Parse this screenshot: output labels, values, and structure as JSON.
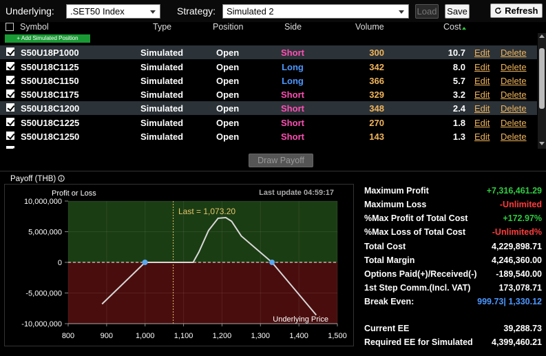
{
  "toolbar": {
    "underlying_label": "Underlying:",
    "underlying_value": ".SET50 Index",
    "strategy_label": "Strategy:",
    "strategy_value": "Simulated 2",
    "load_label": "Load",
    "save_label": "Save",
    "refresh_label": "Refresh"
  },
  "table": {
    "headers": {
      "symbol": "Symbol",
      "type": "Type",
      "position": "Position",
      "side": "Side",
      "volume": "Volume",
      "cost": "Cost"
    },
    "add_label": "+ Add Simulated Position",
    "edit_label": "Edit",
    "delete_label": "Delete",
    "rows": [
      {
        "symbol": "S50U18P1000",
        "type": "Simulated",
        "position": "Open",
        "side": "Short",
        "volume": "300",
        "cost": "10.7"
      },
      {
        "symbol": "S50U18C1125",
        "type": "Simulated",
        "position": "Open",
        "side": "Long",
        "volume": "342",
        "cost": "8.0"
      },
      {
        "symbol": "S50U18C1150",
        "type": "Simulated",
        "position": "Open",
        "side": "Long",
        "volume": "366",
        "cost": "5.7"
      },
      {
        "symbol": "S50U18C1175",
        "type": "Simulated",
        "position": "Open",
        "side": "Short",
        "volume": "329",
        "cost": "3.2"
      },
      {
        "symbol": "S50U18C1200",
        "type": "Simulated",
        "position": "Open",
        "side": "Short",
        "volume": "348",
        "cost": "2.4"
      },
      {
        "symbol": "S50U18C1225",
        "type": "Simulated",
        "position": "Open",
        "side": "Short",
        "volume": "270",
        "cost": "1.8"
      },
      {
        "symbol": "S50U18C1250",
        "type": "Simulated",
        "position": "Open",
        "side": "Short",
        "volume": "143",
        "cost": "1.3"
      }
    ],
    "colors": {
      "short": "#ff4fb5",
      "long": "#4b97ff",
      "volume": "#f0b45a",
      "highlight": "#2b3238"
    }
  },
  "draw_payoff_label": "Draw Payoff",
  "payoff_title": "Payoff (THB)",
  "chart_data": {
    "type": "line",
    "ylabel": "Profit or Loss",
    "xlabel": "Underlying Price",
    "last_update": "Last update 04:59:17",
    "last_label": "Last = 1,073.20",
    "last_value": 1073.2,
    "xlim": [
      800,
      1500
    ],
    "ylim": [
      -10000000,
      10000000
    ],
    "x_ticks": [
      "800",
      "900",
      "1,000",
      "1,100",
      "1,200",
      "1,300",
      "1,400",
      "1,500"
    ],
    "y_ticks": [
      "10,000,000",
      "5,000,000",
      "0",
      "-5,000,000",
      "-10,000,000"
    ],
    "series": [
      {
        "x": [
          888,
          1000,
          1125,
          1140,
          1165,
          1190,
          1210,
          1225,
          1250,
          1330,
          1445
        ],
        "y": [
          -6800000,
          0,
          0,
          1700000,
          5200000,
          7200000,
          7300000,
          6700000,
          4300000,
          0,
          -8600000
        ]
      }
    ],
    "break_even_points": [
      999.73,
      1330.12
    ],
    "colors": {
      "profit_bg": "#1b3d13",
      "loss_bg": "#4a0d0d",
      "line": "#d8d8d8",
      "point": "#5aa8f0",
      "last_line": "#e6c66b"
    }
  },
  "stats": [
    {
      "label": "Maximum Profit",
      "value": "+7,316,461.29",
      "color": "green"
    },
    {
      "label": "Maximum Loss",
      "value": "-Unlimited",
      "color": "red"
    },
    {
      "label": "%Max Profit of Total Cost",
      "value": "+172.97%",
      "color": "green"
    },
    {
      "label": "%Max Loss of Total Cost",
      "value": "-Unlimited%",
      "color": "red"
    },
    {
      "label": "Total Cost",
      "value": "4,229,898.71",
      "color": "white"
    },
    {
      "label": "Total Margin",
      "value": "4,246,360.00",
      "color": "white"
    },
    {
      "label": "Options Paid(+)/Received(-)",
      "value": "-189,540.00",
      "color": "white"
    },
    {
      "label": "1st Step Comm.(Incl. VAT)",
      "value": "173,078.71",
      "color": "white"
    },
    {
      "label": "Break Even:",
      "value": "999.73| 1,330.12",
      "color": "blue"
    },
    {
      "label": "Current EE",
      "value": "39,288.73",
      "color": "white"
    },
    {
      "label": "Required EE for Simulated",
      "value": "4,399,460.21",
      "color": "white"
    }
  ]
}
